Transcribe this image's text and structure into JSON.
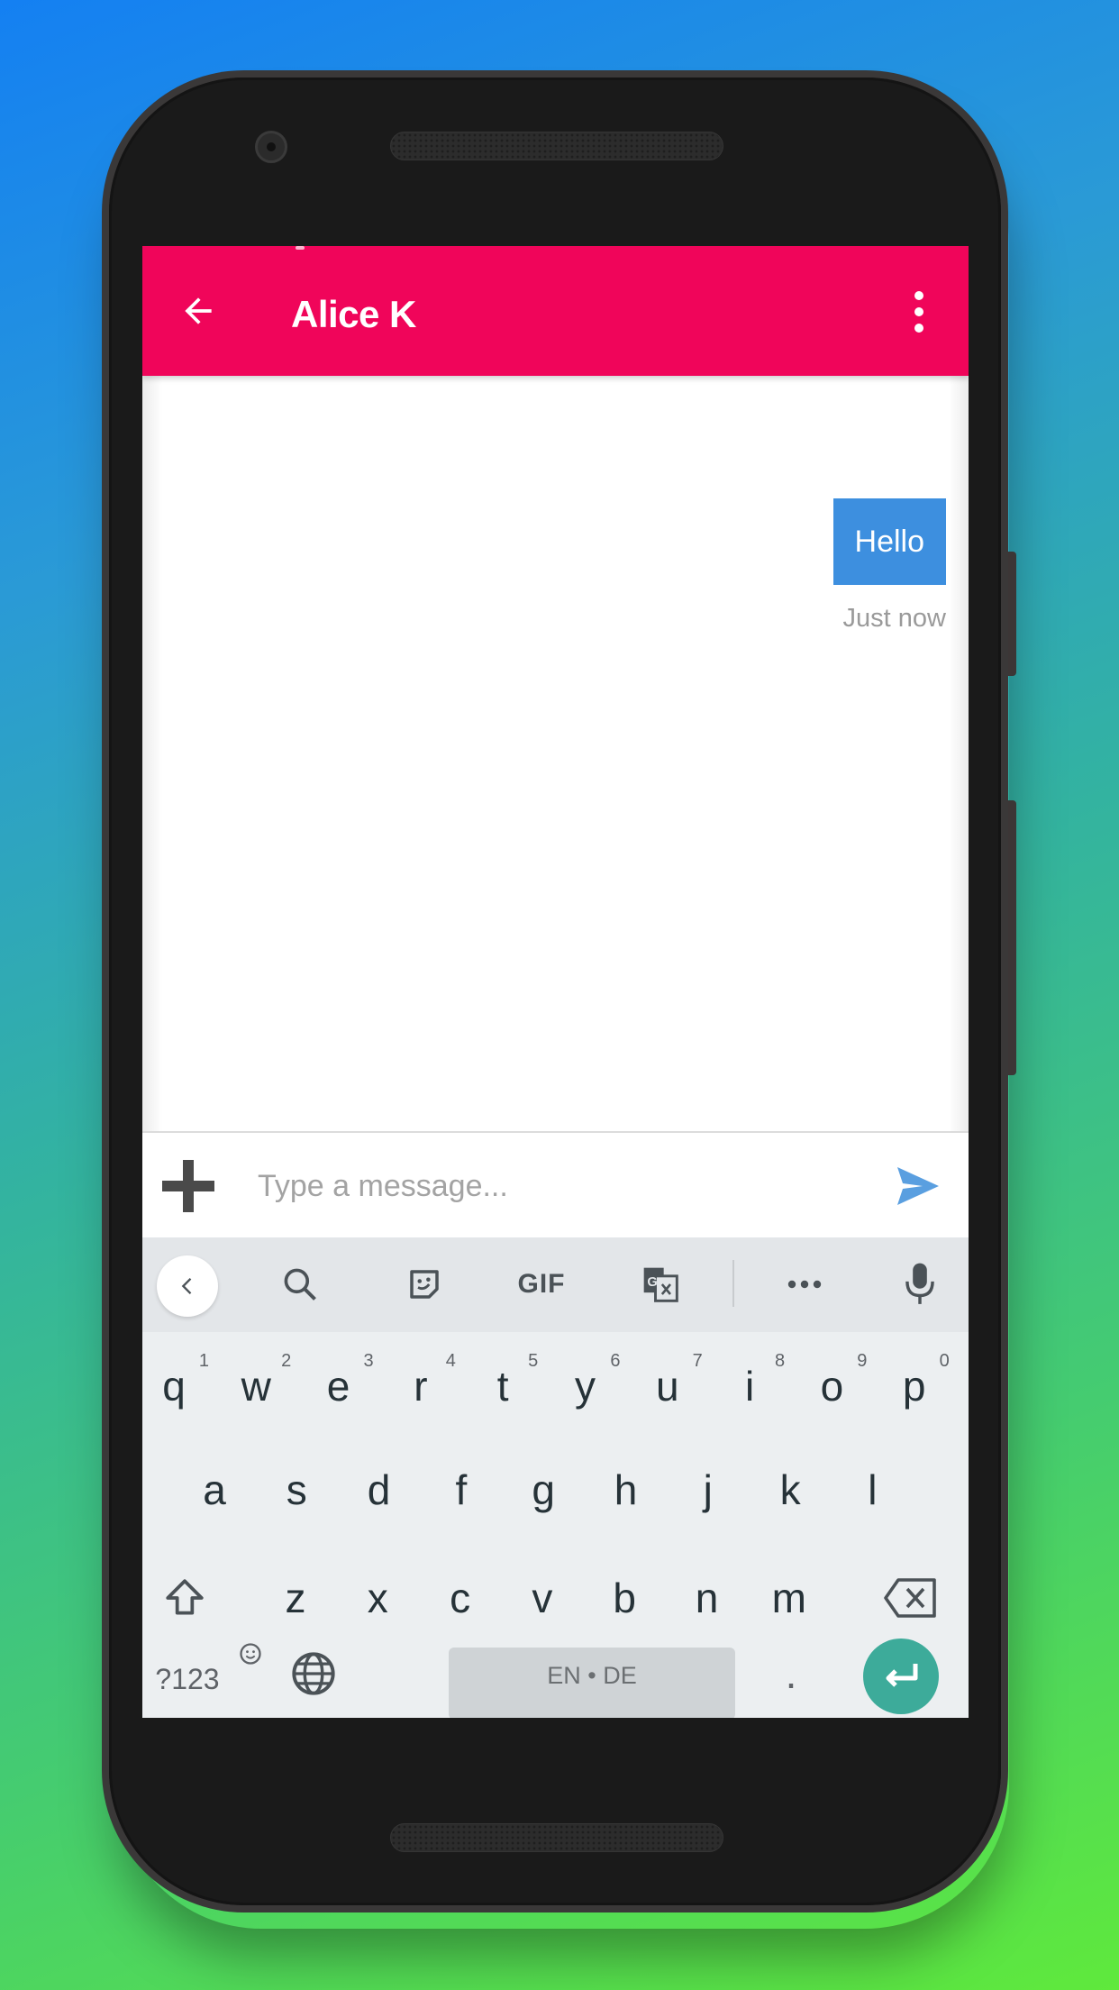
{
  "app": {
    "title": "Alice K",
    "accent_color": "#f0055a",
    "bubble_color": "#3d8fdf"
  },
  "appbar": {
    "back_icon": "arrow-left-icon",
    "menu_icon": "more-vertical-icon"
  },
  "messages": [
    {
      "text": "Hello",
      "timestamp": "Just now",
      "direction": "outgoing"
    }
  ],
  "composer": {
    "placeholder": "Type a message...",
    "value": "",
    "add_icon": "plus-icon",
    "send_icon": "send-icon"
  },
  "keyboard": {
    "toolbar": {
      "collapse_icon": "chevron-left-icon",
      "search_icon": "search-icon",
      "sticker_icon": "sticker-icon",
      "gif_label": "GIF",
      "translate_icon": "translate-icon",
      "more_icon": "more-horizontal-icon",
      "mic_icon": "microphone-icon"
    },
    "rows": [
      [
        {
          "key": "q",
          "hint": "1"
        },
        {
          "key": "w",
          "hint": "2"
        },
        {
          "key": "e",
          "hint": "3"
        },
        {
          "key": "r",
          "hint": "4"
        },
        {
          "key": "t",
          "hint": "5"
        },
        {
          "key": "y",
          "hint": "6"
        },
        {
          "key": "u",
          "hint": "7"
        },
        {
          "key": "i",
          "hint": "8"
        },
        {
          "key": "o",
          "hint": "9"
        },
        {
          "key": "p",
          "hint": "0"
        }
      ],
      [
        {
          "key": "a"
        },
        {
          "key": "s"
        },
        {
          "key": "d"
        },
        {
          "key": "f"
        },
        {
          "key": "g"
        },
        {
          "key": "h"
        },
        {
          "key": "j"
        },
        {
          "key": "k"
        },
        {
          "key": "l"
        }
      ],
      [
        {
          "key": "z"
        },
        {
          "key": "x"
        },
        {
          "key": "c"
        },
        {
          "key": "v"
        },
        {
          "key": "b"
        },
        {
          "key": "n"
        },
        {
          "key": "m"
        }
      ]
    ],
    "shift_icon": "shift-icon",
    "backspace_icon": "backspace-icon",
    "symbols_label": "?123",
    "emoji_icon": "emoji-icon",
    "comma_label": ",",
    "globe_icon": "globe-icon",
    "space_label": "EN • DE",
    "period_label": ".",
    "enter_icon": "enter-icon"
  }
}
